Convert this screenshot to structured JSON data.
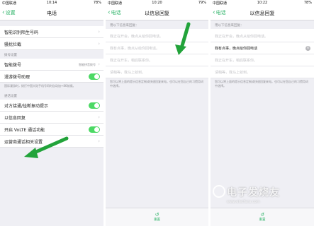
{
  "accent": "#2fb46a",
  "p1": {
    "status": {
      "carrier": "中国联通",
      "time": "10:14",
      "battery": "78%"
    },
    "nav": {
      "back": "设置",
      "title": "电话"
    },
    "group1": [
      {
        "label": "智能识别陌生号码"
      },
      {
        "label": "骚扰拦截"
      }
    ],
    "section2_header": "拨号设置",
    "group2": [
      {
        "label": "智能拨号",
        "sub": "智能拼音拨号"
      },
      {
        "label": "漫游拨号助理"
      }
    ],
    "section2_footnote": "国际漫游时，拨打中国大陆手机号码时自动加+86前缀。",
    "section3_header": "通话设置",
    "group3": [
      {
        "label": "对方接通/挂断振动提示"
      },
      {
        "label": "以信息回复"
      },
      {
        "label": "开启 VoLTE 通话功能"
      },
      {
        "label": "运营商通话相关设置"
      }
    ]
  },
  "p2": {
    "status": {
      "carrier": "中国联通",
      "time": "10:20",
      "battery": "79%"
    },
    "nav": {
      "back": "电话",
      "title": "以信息回复"
    },
    "section_header": "用以下信息来回复：",
    "replies": [
      "我正在开会，晚点从给你回电话。",
      "我有点事，晚点从给你回电话。",
      "我正在开车，稍后联系你。",
      "请稍等，我马上就到。"
    ],
    "footnote": "您可以将上面的提示信息定制成快速回复来电。也可以在您自己的习惯用词中选择。",
    "reset": "重置"
  },
  "p3": {
    "status": {
      "carrier": "中国联通",
      "time": "10:22",
      "battery": "78%"
    },
    "nav": {
      "back": "电话",
      "title": "以信息回复"
    },
    "section_header": "用以下信息来回复：",
    "replies": [
      "我正在开会，晚点从给你回电话。",
      "我有点事，晚点给你回电话",
      "我正在开车，稍后联系你。",
      "请稍等，我马上就到。"
    ],
    "footnote": "您可以将上面的提示信息定制成快速回复来电。也可以在您自己的习惯用词中选择。",
    "reset": "重置"
  },
  "watermark": {
    "title": "电子发烧友",
    "sub": "www.elecfans.com"
  }
}
